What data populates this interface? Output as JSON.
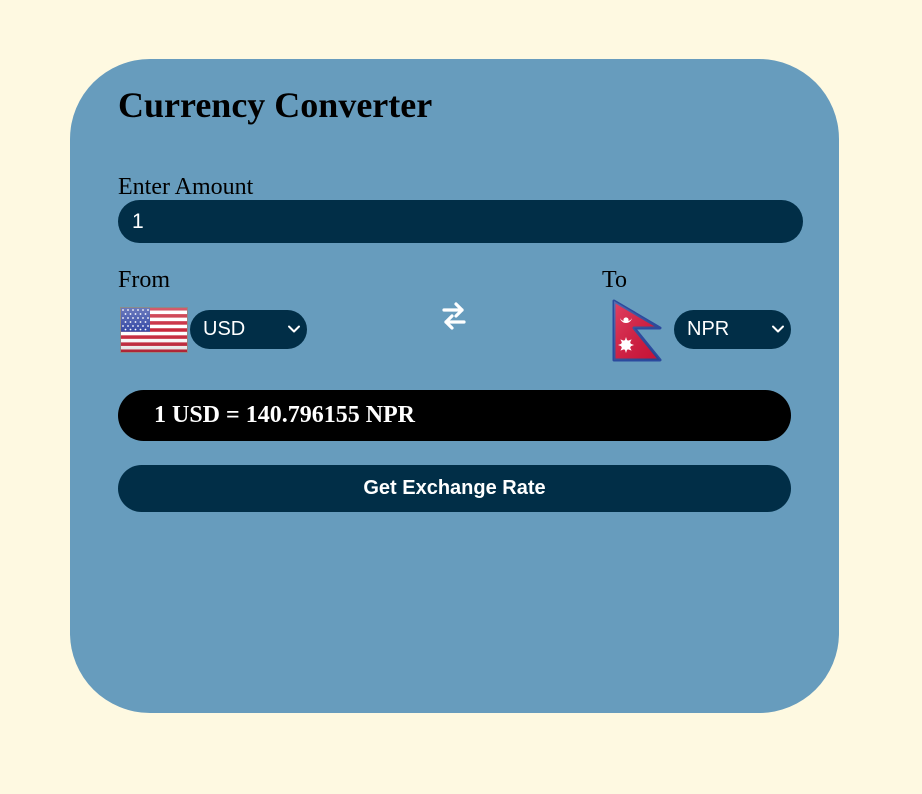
{
  "title": "Currency Converter",
  "amount": {
    "label": "Enter Amount",
    "value": "1"
  },
  "from": {
    "label": "From",
    "currency": "USD",
    "flag_icon": "us-flag-icon"
  },
  "to": {
    "label": "To",
    "currency": "NPR",
    "flag_icon": "nepal-flag-icon"
  },
  "swap_icon": "swap-arrows-icon",
  "result_text": "1 USD = 140.796155 NPR",
  "action_button_label": "Get Exchange Rate",
  "colors": {
    "page_background": "#fef9e1",
    "card_background": "#679cbd",
    "control_background": "#012e47",
    "result_background": "#000000",
    "text_light": "#ffffff"
  }
}
